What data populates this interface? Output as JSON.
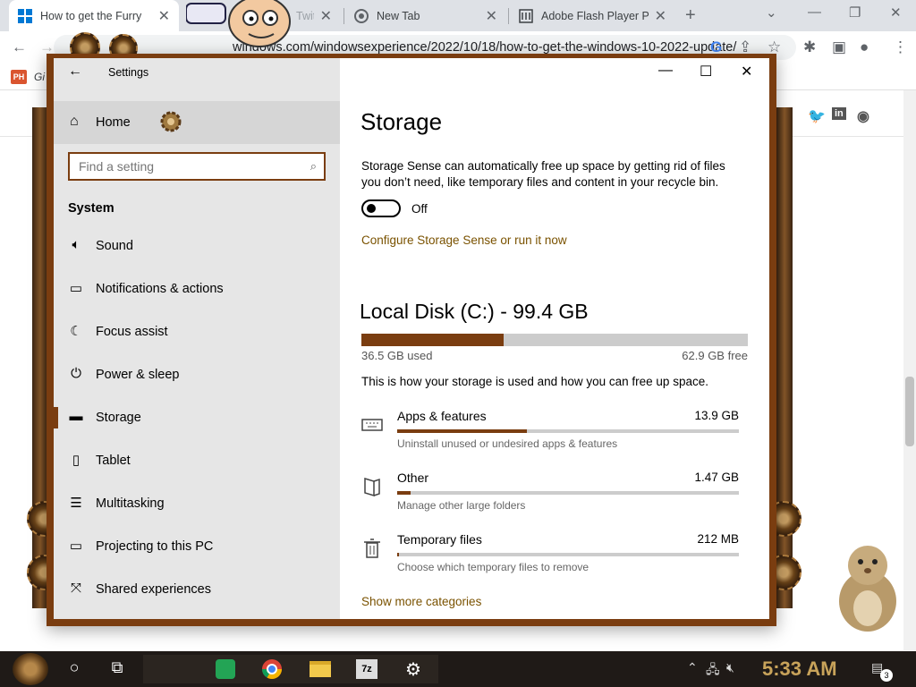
{
  "browser": {
    "tabs": [
      {
        "title": "How to get the Furry",
        "active": true
      },
      {
        "title": "Twit",
        "active": false
      },
      {
        "title": "New Tab",
        "active": false
      },
      {
        "title": "Adobe Flash Player P",
        "active": false
      }
    ],
    "url_main": "windows.com/windowsexperience/2022/10/18/how-to-get-the-windows-10-2022-update/",
    "bookmark_label": "Gi",
    "bookmark_badge": "PH"
  },
  "settings": {
    "window_title": "Settings",
    "home_label": "Home",
    "search_placeholder": "Find a setting",
    "section_label": "System",
    "nav_items": [
      {
        "label": "Sound",
        "icon": "speaker-icon",
        "selected": false
      },
      {
        "label": "Notifications & actions",
        "icon": "notification-icon",
        "selected": false
      },
      {
        "label": "Focus assist",
        "icon": "moon-icon",
        "selected": false
      },
      {
        "label": "Power & sleep",
        "icon": "power-icon",
        "selected": false
      },
      {
        "label": "Storage",
        "icon": "storage-icon",
        "selected": true
      },
      {
        "label": "Tablet",
        "icon": "tablet-icon",
        "selected": false
      },
      {
        "label": "Multitasking",
        "icon": "multitasking-icon",
        "selected": false
      },
      {
        "label": "Projecting to this PC",
        "icon": "projecting-icon",
        "selected": false
      },
      {
        "label": "Shared experiences",
        "icon": "shared-icon",
        "selected": false
      }
    ],
    "page_title": "Storage",
    "storage_sense_text": "Storage Sense can automatically free up space by getting rid of files you don’t need, like temporary files and content in your recycle bin.",
    "toggle_state": "Off",
    "configure_link": "Configure Storage Sense or run it now",
    "disk_title": "Local Disk (C:) - 99.4 GB",
    "disk_used_label": "36.5 GB used",
    "disk_free_label": "62.9 GB free",
    "disk_used_fraction": 0.367,
    "disk_description": "This is how your storage is used and how you can free up space.",
    "categories": [
      {
        "name": "Apps & features",
        "size": "13.9 GB",
        "desc": "Uninstall unused or undesired apps & features",
        "fraction": 0.38,
        "icon": "keyboard-icon"
      },
      {
        "name": "Other",
        "size": "1.47 GB",
        "desc": "Manage other large folders",
        "fraction": 0.04,
        "icon": "folder-icon"
      },
      {
        "name": "Temporary files",
        "size": "212 MB",
        "desc": "Choose which temporary files to remove",
        "fraction": 0.006,
        "icon": "trash-icon"
      }
    ],
    "show_more_link": "Show more categories"
  },
  "taskbar": {
    "clock": "5:33 AM",
    "notification_count": "3"
  },
  "colors": {
    "accent": "#7a3d10",
    "link": "#7a5200",
    "taskbar": "#1f1a17",
    "clock": "#c8a35a"
  }
}
